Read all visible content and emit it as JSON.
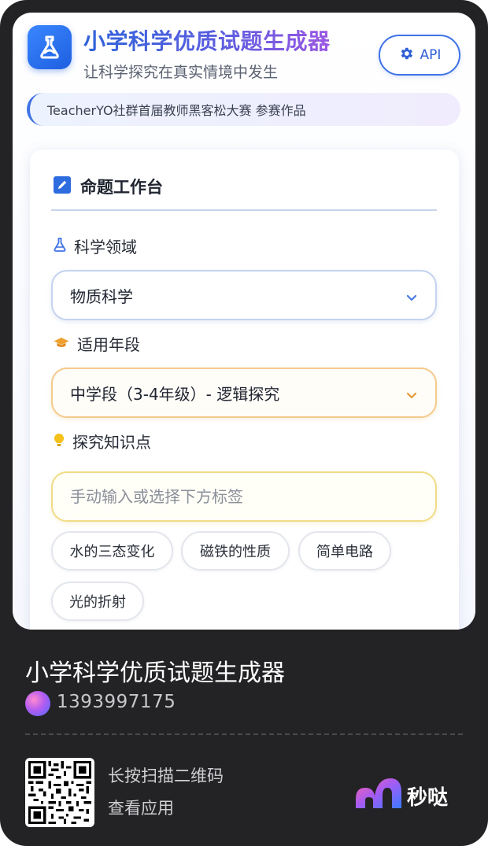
{
  "header": {
    "title": "小学科学优质试题生成器",
    "subtitle": "让科学探究在真实情境中发生",
    "api_label": "API"
  },
  "banner": {
    "text": "TeacherYO社群首届教师黑客松大赛 参赛作品"
  },
  "workbench": {
    "title": "命题工作台",
    "domain_label": "科学领域",
    "domain_value": "物质科学",
    "grade_label": "适用年段",
    "grade_value": "中学段（3-4年级）- 逻辑探究",
    "knowledge_label": "探究知识点",
    "knowledge_placeholder": "手动输入或选择下方标签",
    "knowledge_value": "",
    "tags": [
      "水的三态变化",
      "磁铁的性质",
      "简单电路",
      "光的折射"
    ]
  },
  "footer": {
    "app_name": "小学科学优质试题生成器",
    "author_id": "1393997175",
    "qr_hint": "长按扫描二维码",
    "qr_action": "查看应用",
    "brand_name": "秒哒"
  },
  "colors": {
    "accent": "#3f73e6",
    "title_gradient_end": "#9b57e2",
    "amber": "#f3ca8c",
    "yellow": "#f1dc86",
    "outer_background": "#232325"
  },
  "icons": {
    "logo": "flask-leaf-icon",
    "api": "gear-icon",
    "workbench": "edit-icon",
    "domain": "flask-icon",
    "grade": "graduation-cap-icon",
    "knowledge": "lightbulb-icon",
    "dropdown": "chevron-down-icon",
    "qr": "qr-code-icon",
    "brand": "miaoda-logo-icon"
  }
}
